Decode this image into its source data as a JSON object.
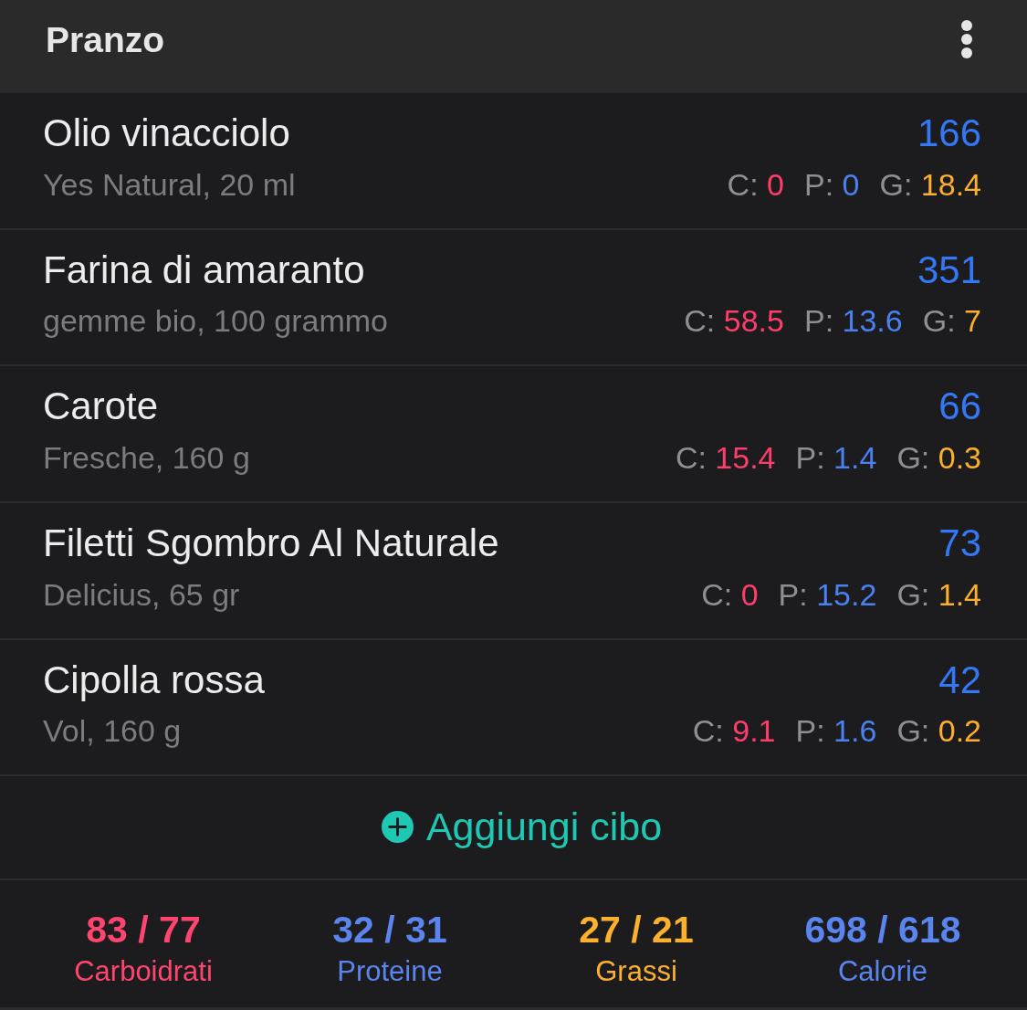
{
  "header": {
    "title": "Pranzo"
  },
  "foods": [
    {
      "name": "Olio vinacciolo",
      "detail": "Yes Natural, 20 ml",
      "calories": "166",
      "macros": [
        {
          "label": "C:",
          "value": "0",
          "color": "#ff3d6c"
        },
        {
          "label": "P:",
          "value": "0",
          "color": "#4a80f0"
        },
        {
          "label": "G:",
          "value": "18.4",
          "color": "#fcaf2c"
        }
      ]
    },
    {
      "name": "Farina di amaranto",
      "detail": "gemme bio, 100 grammo",
      "calories": "351",
      "macros": [
        {
          "label": "C:",
          "value": "58.5",
          "color": "#ff3d6c"
        },
        {
          "label": "P:",
          "value": "13.6",
          "color": "#4a80f0"
        },
        {
          "label": "G:",
          "value": "7",
          "color": "#fcaf2c"
        }
      ]
    },
    {
      "name": "Carote",
      "detail": "Fresche, 160 g",
      "calories": "66",
      "macros": [
        {
          "label": "C:",
          "value": "15.4",
          "color": "#ff3d6c"
        },
        {
          "label": "P:",
          "value": "1.4",
          "color": "#4a80f0"
        },
        {
          "label": "G:",
          "value": "0.3",
          "color": "#fcaf2c"
        }
      ]
    },
    {
      "name": "Filetti Sgombro Al Naturale",
      "detail": "Delicius, 65 gr",
      "calories": "73",
      "macros": [
        {
          "label": "C:",
          "value": "0",
          "color": "#ff3d6c"
        },
        {
          "label": "P:",
          "value": "15.2",
          "color": "#4a80f0"
        },
        {
          "label": "G:",
          "value": "1.4",
          "color": "#fcaf2c"
        }
      ]
    },
    {
      "name": "Cipolla rossa",
      "detail": "Vol, 160 g",
      "calories": "42",
      "macros": [
        {
          "label": "C:",
          "value": "9.1",
          "color": "#ff3d6c"
        },
        {
          "label": "P:",
          "value": "1.6",
          "color": "#4a80f0"
        },
        {
          "label": "G:",
          "value": "0.2",
          "color": "#fcaf2c"
        }
      ]
    }
  ],
  "add_button": {
    "label": "Aggiungi cibo"
  },
  "totals": [
    {
      "value": "83 / 77",
      "label": "Carboidrati",
      "color": "#ff456f"
    },
    {
      "value": "32 / 31",
      "label": "Proteine",
      "color": "#5a84ee"
    },
    {
      "value": "27 / 21",
      "label": "Grassi",
      "color": "#fbb02e"
    },
    {
      "value": "698 / 618",
      "label": "Calorie",
      "color": "#5a84ee"
    }
  ]
}
